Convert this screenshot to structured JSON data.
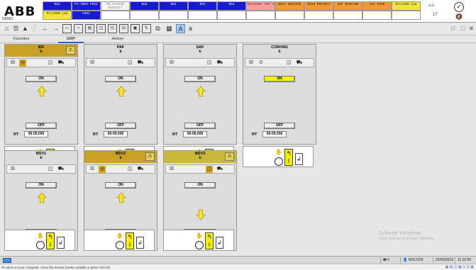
{
  "app": {
    "logo": "ABB",
    "system": "DEMO"
  },
  "alarm_band": {
    "row1": [
      {
        "text": "0S1",
        "color": "blue"
      },
      {
        "text": "FC-7BSA FDX2",
        "color": "blue"
      },
      {
        "text": "MV_Cosnt0 TestCtrl",
        "color": "white"
      },
      {
        "text": "0S1",
        "color": "blue"
      },
      {
        "text": "0S1",
        "color": "blue"
      },
      {
        "text": "0S1",
        "color": "blue"
      },
      {
        "text": "0S1",
        "color": "blue"
      },
      {
        "text": "SAFLEVEL FDV 2",
        "color": "red"
      },
      {
        "text": "BSV3 RUNTIME",
        "color": "orange"
      },
      {
        "text": "BSV3 PROTECT",
        "color": "orange"
      },
      {
        "text": "IDF RUNTIME",
        "color": "orange"
      },
      {
        "text": "FIC FEDR",
        "color": "orange"
      },
      {
        "text": "Pct1200 Low",
        "color": "yellow"
      }
    ],
    "row2": [
      {
        "text": "Pct1200 Low",
        "color": "yellow"
      },
      {
        "text": "FDX1",
        "color": "blue"
      }
    ],
    "expand_label": ">>",
    "count": "17",
    "ack_icon": "checkmark-circle-icon",
    "sound_icon": "speaker-mute-icon"
  },
  "toolbar": {
    "icons": [
      "home-icon",
      "tree-icon",
      "alert-icon",
      "info-icon",
      "back-icon",
      "forward-icon",
      "display-icon",
      "trend-icon",
      "faceplate-icon",
      "group-icon",
      "graphics-icon",
      "graphics-edit-icon",
      "overview-icon",
      "rotate-icon",
      "workplace-icon",
      "window-icon",
      "font-a-icon",
      "font-a-small-icon"
    ],
    "right_icons": [
      "minimize-icon",
      "restore-icon",
      "menu-icon"
    ]
  },
  "tabs": [
    {
      "label": "Favorites",
      "active": false
    },
    {
      "label": "GRP",
      "active": true
    },
    {
      "label": "History",
      "active": false
    }
  ],
  "faceplates": [
    {
      "name": "IDF",
      "sub": "b",
      "header": "gold",
      "warn": true,
      "rt": "00:05.000",
      "on_label": "ON",
      "off_label": "OFF",
      "on_lit": false,
      "arrow": "up",
      "icons_hl": true
    },
    {
      "name": "PAF",
      "sub": "b",
      "header": "grey",
      "warn": false,
      "rt": "00:05.000",
      "on_label": "ON",
      "off_label": "OFF",
      "on_lit": false,
      "arrow": "up",
      "icons_hl": false
    },
    {
      "name": "SAF",
      "sub": "b",
      "header": "grey",
      "warn": false,
      "rt": "00:05.000",
      "on_label": "ON",
      "off_label": "OFF",
      "on_lit": false,
      "arrow": "up",
      "icons_hl": false
    },
    {
      "name": "CONVM1",
      "sub": "b",
      "header": "grey",
      "warn": false,
      "rt": "00:05.000",
      "on_label": "ON",
      "off_label": "OFF",
      "on_lit": true,
      "arrow": "none",
      "icons_hl": false
    },
    {
      "name": "BSV1",
      "sub": "b",
      "header": "grey",
      "warn": false,
      "rt": "00:05.000",
      "on_label": "ON",
      "off_label": "OFF",
      "on_lit": false,
      "arrow": "up",
      "icons_hl": false
    },
    {
      "name": "BSV2",
      "sub": "b",
      "header": "gold",
      "warn": true,
      "rt": "00:05.000",
      "on_label": "ON",
      "off_label": "OFF",
      "on_lit": false,
      "arrow": "up",
      "icons_hl": true
    },
    {
      "name": "BSV3",
      "sub": "b",
      "header": "olive",
      "warn": true,
      "rt": "00:05.000",
      "on_label": "ON",
      "off_label": "OFF",
      "on_lit": false,
      "arrow": "down",
      "icons_hl": true
    }
  ],
  "rt_label": "RT",
  "watermark": {
    "title": "Activate Windows",
    "sub": "Go to Settings to activate Windows."
  },
  "statusbar": {
    "printer": "0",
    "user": "NOLOCK",
    "date": "22/03/2019",
    "time": "11:10:50"
  },
  "hint": "To return to your computer, move the mouse pointer outside or press Ctrl+Alt."
}
